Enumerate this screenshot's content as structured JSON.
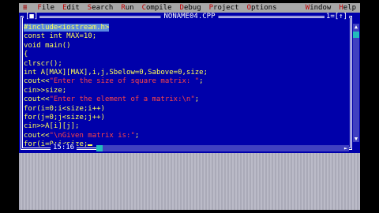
{
  "menubar": {
    "system_glyph": "≡",
    "items": [
      "File",
      "Edit",
      "Search",
      "Run",
      "Compile",
      "Debug",
      "Project",
      "Options"
    ],
    "window_label": "Window",
    "help_label": "Help"
  },
  "window": {
    "close_glyph": "[■]",
    "title": "NONAME04.CPP",
    "number_label": "1=[↑]"
  },
  "code_lines": [
    {
      "parts": [
        {
          "t": "#include<iostream.h>",
          "k": "sel"
        }
      ]
    },
    {
      "parts": [
        {
          "t": "const int MAX=10;",
          "k": "code"
        }
      ]
    },
    {
      "parts": [
        {
          "t": "void main()",
          "k": "code"
        }
      ]
    },
    {
      "parts": [
        {
          "t": "{",
          "k": "code"
        }
      ]
    },
    {
      "parts": [
        {
          "t": "clrscr();",
          "k": "code"
        }
      ]
    },
    {
      "parts": [
        {
          "t": "int A[MAX][MAX],i,j,Sbelow=0,Sabove=0,size;",
          "k": "code"
        }
      ]
    },
    {
      "parts": [
        {
          "t": "cout<<",
          "k": "code"
        },
        {
          "t": "\"Enter the size of square matrix: \"",
          "k": "str"
        },
        {
          "t": ";",
          "k": "code"
        }
      ]
    },
    {
      "parts": [
        {
          "t": "cin>>size;",
          "k": "code"
        }
      ]
    },
    {
      "parts": [
        {
          "t": "cout<<",
          "k": "code"
        },
        {
          "t": "\"Enter the element of a matrix:\\n\"",
          "k": "str"
        },
        {
          "t": ";",
          "k": "code"
        }
      ]
    },
    {
      "parts": [
        {
          "t": "for(i=0;i<size;i++)",
          "k": "code"
        }
      ]
    },
    {
      "parts": [
        {
          "t": "for(j=0;j<size;j++)",
          "k": "code"
        }
      ]
    },
    {
      "parts": [
        {
          "t": "cin>>A[i][j];",
          "k": "code"
        }
      ]
    },
    {
      "parts": [
        {
          "t": "cout<<",
          "k": "code"
        },
        {
          "t": "\"\\nGiven matrix is:\"",
          "k": "str"
        },
        {
          "t": ";",
          "k": "code"
        }
      ]
    },
    {
      "parts": [
        {
          "t": "for(i=0;i<size;",
          "k": "code"
        },
        {
          "t": "",
          "k": "cursor"
        }
      ]
    }
  ],
  "status": {
    "position": "15:16"
  },
  "colors": {
    "editor_bg": "#0000aa",
    "code": "#ffff55",
    "string": "#ff4444",
    "menubar": "#a8a8a8"
  }
}
